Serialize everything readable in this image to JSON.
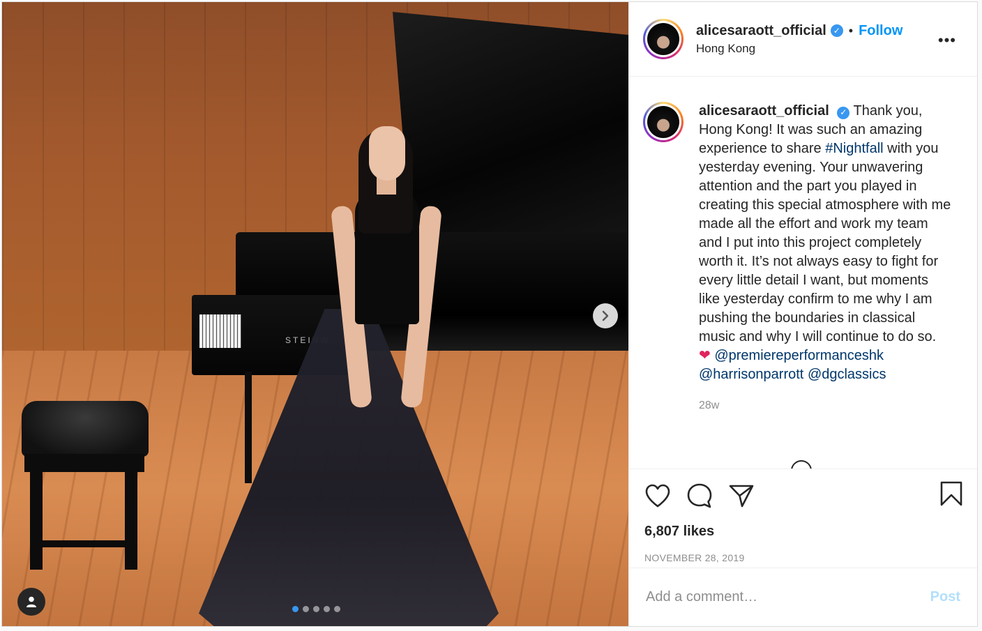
{
  "photo": {
    "piano_brand": "STEINW",
    "carousel_total": 5,
    "carousel_active": 1
  },
  "header": {
    "username": "alicesaraott_official",
    "separator": "•",
    "follow_label": "Follow",
    "location": "Hong Kong",
    "more_label": "•••"
  },
  "caption": {
    "username": "alicesaraott_official",
    "text_1": "Thank you, Hong Kong! It was such an amazing experience to share ",
    "hashtag": "#Nightfall",
    "text_2": " with you yesterday evening. Your unwavering attention and the part you played in creating this special atmosphere with me made all the effort and work my team and I put into this project completely worth it. It’s not always easy to fight for every little detail I want, but moments like yesterday confirm to me why I am pushing the boundaries in classical music and why I will continue to do so.",
    "heart": "❤",
    "mention_1": "@premiereperformanceshk",
    "mention_2": "@harrisonparrott",
    "mention_3": "@dgclassics",
    "time_ago": "28w"
  },
  "actions": {
    "likes": "6,807 likes",
    "date": "NOVEMBER 28, 2019"
  },
  "comment": {
    "placeholder": "Add a comment…",
    "post_label": "Post"
  },
  "colors": {
    "accent": "#0095f6",
    "verified": "#3897f0",
    "link": "#00376b",
    "post_disabled": "#b2dffc"
  }
}
